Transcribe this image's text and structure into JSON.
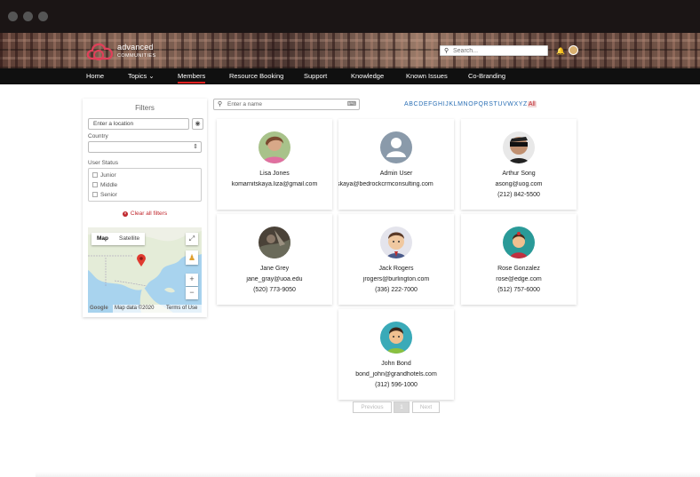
{
  "brand": {
    "name": "advanced",
    "sub": "COMMUNITIES"
  },
  "header": {
    "search_placeholder": "Search..."
  },
  "nav": {
    "items": [
      {
        "label": "Home"
      },
      {
        "label": "Topics ⌄"
      },
      {
        "label": "Members"
      },
      {
        "label": "Resource Booking"
      },
      {
        "label": "Support"
      },
      {
        "label": "Knowledge"
      },
      {
        "label": "Known Issues"
      },
      {
        "label": "Co-Branding"
      }
    ],
    "active_index": 2
  },
  "filters": {
    "title": "Filters",
    "location_placeholder": "Enter a location",
    "country_label": "Country",
    "user_status_label": "User Status",
    "statuses": [
      "Junior",
      "Middle",
      "Senior"
    ],
    "clear_label": "Clear all filters"
  },
  "map": {
    "tab_map": "Map",
    "tab_satellite": "Satellite",
    "brand": "Google",
    "data_label": "Map data ©2020",
    "terms_label": "Terms of Use"
  },
  "members_search": {
    "placeholder": "Enter a name"
  },
  "alphabet": {
    "letters": [
      "A",
      "B",
      "C",
      "D",
      "E",
      "F",
      "G",
      "H",
      "I",
      "J",
      "K",
      "L",
      "M",
      "N",
      "O",
      "P",
      "Q",
      "R",
      "S",
      "T",
      "U",
      "V",
      "W",
      "X",
      "Y",
      "Z"
    ],
    "all_label": "All"
  },
  "members": [
    {
      "name": "Lisa Jones",
      "email": "komarnitskaya.liza@gmail.com",
      "phone": ""
    },
    {
      "name": "Admin User",
      "email": "komarnitskaya@bedrockcrmconsulting.com",
      "phone": ""
    },
    {
      "name": "Arthur Song",
      "email": "asong@uog.com",
      "phone": "(212) 842-5500"
    },
    {
      "name": "Jane Grey",
      "email": "jane_gray@uoa.edu",
      "phone": "(520) 773-9050"
    },
    {
      "name": "Jack Rogers",
      "email": "jrogers@burlington.com",
      "phone": "(336) 222-7000"
    },
    {
      "name": "Rose Gonzalez",
      "email": "rose@edge.com",
      "phone": "(512) 757-6000"
    },
    {
      "name": "John Bond",
      "email": "bond_john@grandhotels.com",
      "phone": "(312) 596-1000"
    }
  ],
  "pagination": {
    "previous": "Previous",
    "current": "1",
    "next": "Next"
  },
  "colors": {
    "accent": "#c0272d",
    "link": "#2a6fb5",
    "nav_bg": "#101010"
  }
}
